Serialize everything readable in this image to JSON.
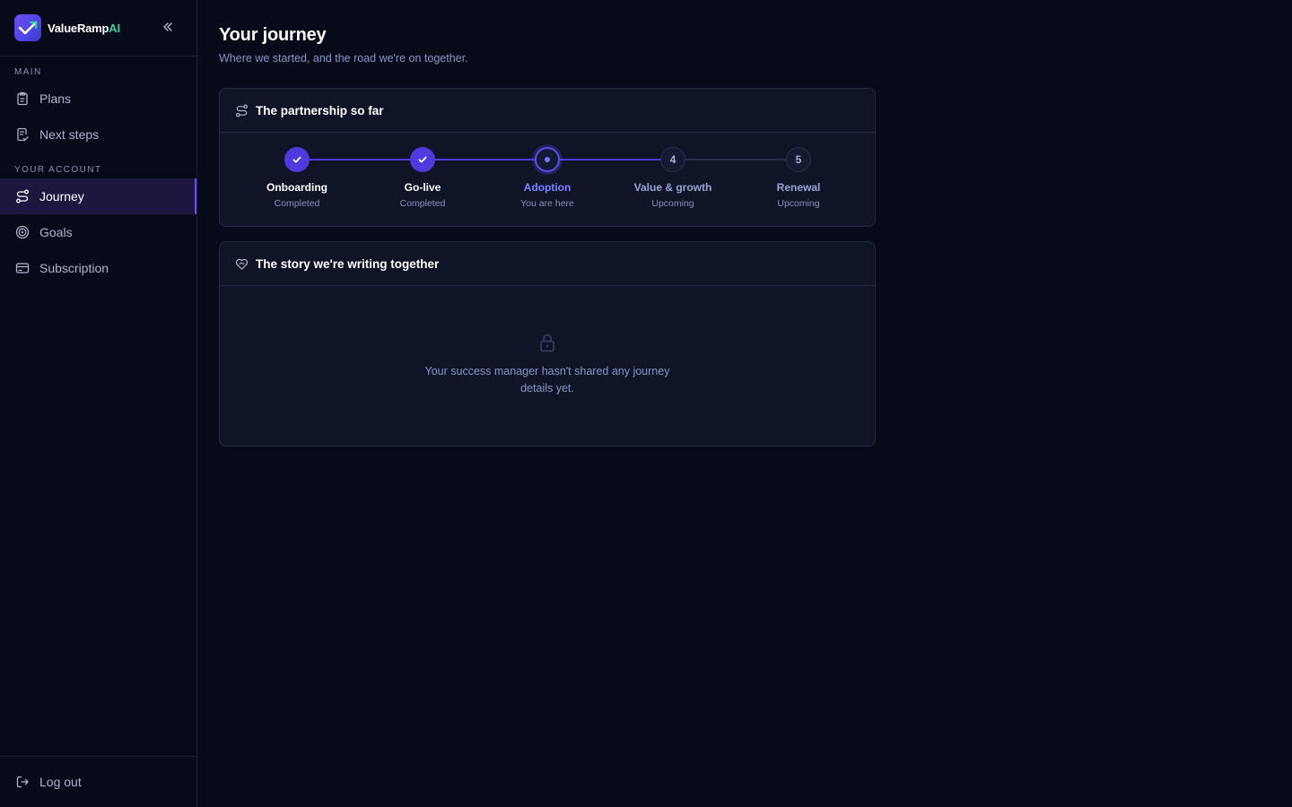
{
  "brand": {
    "name": "ValueRamp",
    "suffix": "AI"
  },
  "sidebar": {
    "sections": [
      {
        "label": "MAIN"
      },
      {
        "label": "YOUR ACCOUNT"
      }
    ],
    "items": [
      {
        "label": "Plans",
        "icon": "clipboard-icon"
      },
      {
        "label": "Next steps",
        "icon": "checklist-icon"
      },
      {
        "label": "Journey",
        "icon": "route-icon",
        "active": true
      },
      {
        "label": "Goals",
        "icon": "target-icon"
      },
      {
        "label": "Subscription",
        "icon": "card-icon"
      }
    ],
    "logout": {
      "label": "Log out",
      "icon": "logout-icon"
    }
  },
  "page": {
    "title": "Your journey",
    "subtitle": "Where we started, and the road we're on together."
  },
  "partnership": {
    "title": "The partnership so far",
    "steps": [
      {
        "name": "Onboarding",
        "status": "Completed",
        "state": "done"
      },
      {
        "name": "Go-live",
        "status": "Completed",
        "state": "done"
      },
      {
        "name": "Adoption",
        "status": "You are here",
        "state": "current"
      },
      {
        "name": "Value & growth",
        "status": "Upcoming",
        "state": "upcoming",
        "number": "4"
      },
      {
        "name": "Renewal",
        "status": "Upcoming",
        "state": "upcoming",
        "number": "5"
      }
    ]
  },
  "story": {
    "title": "The story we're writing together",
    "empty_text": "Your success manager hasn't shared any journey details yet."
  },
  "colors": {
    "accent": "#4f3ae0",
    "accent_light": "#7b86ff",
    "brand_ai": "#34d399",
    "background": "#070a19",
    "card": "#0f1426"
  }
}
